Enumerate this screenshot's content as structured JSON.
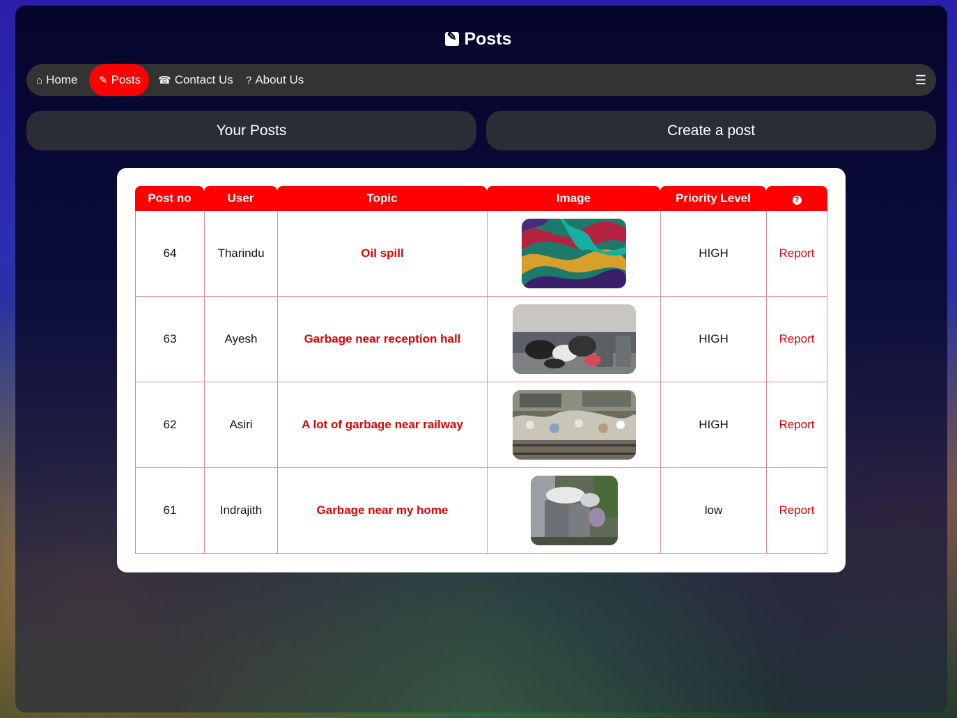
{
  "page": {
    "title": "Posts"
  },
  "nav": {
    "items": [
      {
        "label": "Home",
        "glyph": "⌂"
      },
      {
        "label": "Posts",
        "glyph": "✎"
      },
      {
        "label": "Contact Us",
        "glyph": "☎"
      },
      {
        "label": "About Us",
        "glyph": "?"
      }
    ],
    "menu_icon": "☰"
  },
  "actions": {
    "your_posts": "Your Posts",
    "create_post": "Create a post"
  },
  "table": {
    "headers": [
      "Post no",
      "User",
      "Topic",
      "Image",
      "Priority Level",
      "?"
    ],
    "rows": [
      {
        "no": "64",
        "user": "Tharindu",
        "topic": "Oil spill",
        "image": "oil-spill-photo",
        "priority": "HIGH",
        "action": "Report"
      },
      {
        "no": "63",
        "user": "Ayesh",
        "topic": "Garbage near reception hall",
        "image": "garbage-bags-photo",
        "priority": "HIGH",
        "action": "Report"
      },
      {
        "no": "62",
        "user": "Asiri",
        "topic": "A lot of garbage near railway",
        "image": "railway-garbage-photo",
        "priority": "HIGH",
        "action": "Report"
      },
      {
        "no": "61",
        "user": "Indrajith",
        "topic": "Garbage near my home",
        "image": "bins-garbage-photo",
        "priority": "low",
        "action": "Report"
      }
    ]
  },
  "colors": {
    "accent": "#ff0000",
    "navbar": "#333333",
    "button": "#2a2d36"
  }
}
